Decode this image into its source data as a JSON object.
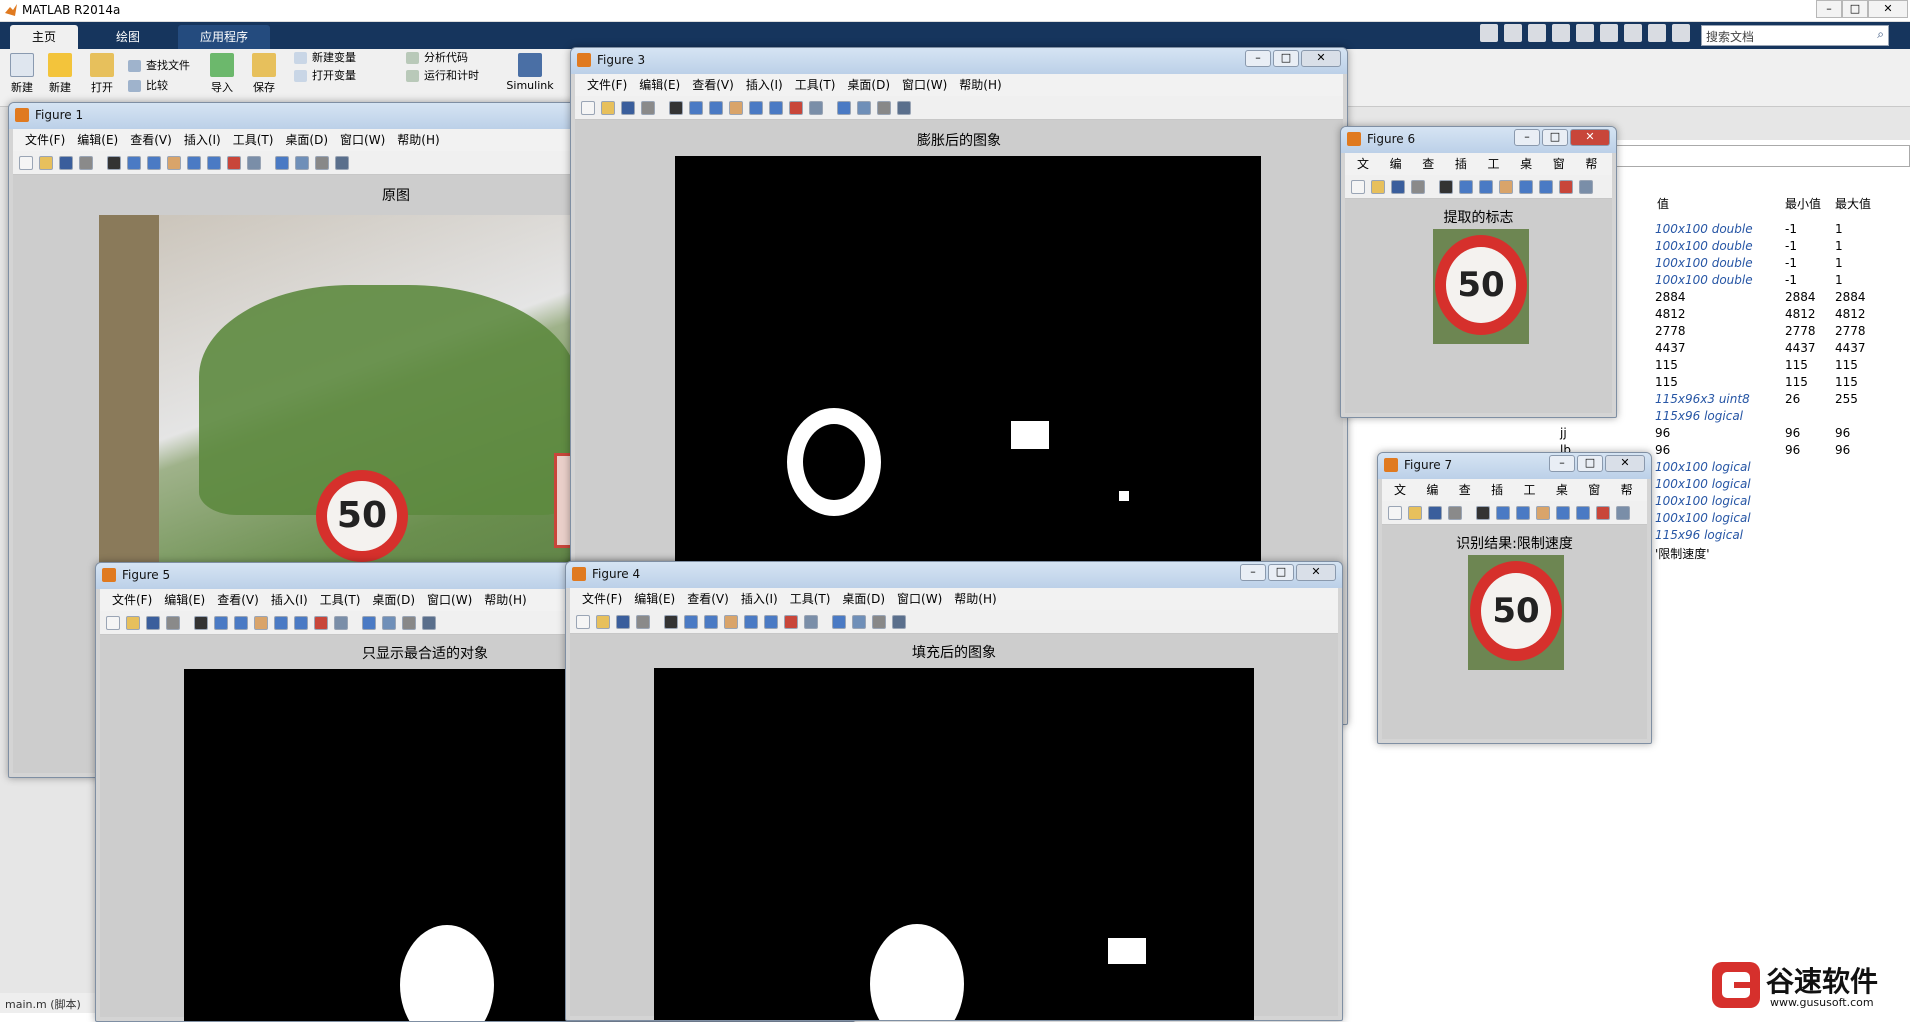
{
  "app": {
    "title": "MATLAB R2014a",
    "window_controls": [
      "–",
      "□",
      "✕"
    ]
  },
  "ribbon": {
    "tabs": [
      {
        "label": "主页",
        "active": true
      },
      {
        "label": "绘图",
        "active": false
      },
      {
        "label": "应用程序",
        "active": false
      }
    ],
    "search_placeholder": "搜索文档",
    "big_buttons": [
      "新建",
      "新建",
      "打开",
      "导入",
      "保存",
      "Simulink"
    ],
    "small_buttons": [
      "查找文件",
      "比较",
      "新建变量",
      "打开变量",
      "分析代码",
      "运行和计时"
    ]
  },
  "workspace": {
    "columns": [
      "值",
      "最小值",
      "最大值"
    ],
    "rows": [
      {
        "value": "100x100 double",
        "min": "-1",
        "max": "1",
        "italic": true
      },
      {
        "value": "100x100 double",
        "min": "-1",
        "max": "1",
        "italic": true
      },
      {
        "value": "100x100 double",
        "min": "-1",
        "max": "1",
        "italic": true
      },
      {
        "value": "100x100 double",
        "min": "-1",
        "max": "1",
        "italic": true
      },
      {
        "value": "2884",
        "min": "2884",
        "max": "2884",
        "italic": false
      },
      {
        "value": "4812",
        "min": "4812",
        "max": "4812",
        "italic": false
      },
      {
        "value": "2778",
        "min": "2778",
        "max": "2778",
        "italic": false
      },
      {
        "value": "4437",
        "min": "4437",
        "max": "4437",
        "italic": false
      },
      {
        "value": "115",
        "min": "115",
        "max": "115",
        "italic": false
      },
      {
        "value": "115",
        "min": "115",
        "max": "115",
        "italic": false
      },
      {
        "value": "115x96x3 uint8",
        "min": "26",
        "max": "255",
        "italic": true
      },
      {
        "value": "115x96 logical",
        "min": "",
        "max": "",
        "italic": true
      },
      {
        "value": "96",
        "min": "96",
        "max": "96",
        "italic": false,
        "name": "jj"
      },
      {
        "value": "96",
        "min": "96",
        "max": "96",
        "italic": false,
        "name": "lb"
      },
      {
        "value": "100x100 logical",
        "min": "",
        "max": "",
        "italic": true
      },
      {
        "value": "100x100 logical",
        "min": "",
        "max": "",
        "italic": true
      },
      {
        "value": "100x100 logical",
        "min": "",
        "max": "",
        "italic": true
      },
      {
        "value": "100x100 logical",
        "min": "",
        "max": "",
        "italic": true
      },
      {
        "value": "115x96 logical",
        "min": "",
        "max": "",
        "italic": true
      },
      {
        "value": "'限制速度'",
        "min": "",
        "max": "",
        "italic": false
      }
    ]
  },
  "status_bar": "main.m (脚本)",
  "figures": {
    "menu_full": [
      "文件(F)",
      "编辑(E)",
      "查看(V)",
      "插入(I)",
      "工具(T)",
      "桌面(D)",
      "窗口(W)",
      "帮助(H)"
    ],
    "menu_short": [
      "文件",
      "编辑",
      "查看",
      "插入",
      "工具",
      "桌面",
      "窗口",
      "帮助"
    ],
    "fig1": {
      "title": "Figure 1",
      "caption": "原图"
    },
    "fig3": {
      "title": "Figure 3",
      "caption": "膨胀后的图象"
    },
    "fig4": {
      "title": "Figure 4",
      "caption": "填充后的图象"
    },
    "fig5": {
      "title": "Figure 5",
      "caption": "只显示最合适的对象"
    },
    "fig6": {
      "title": "Figure 6",
      "caption": "提取的标志"
    },
    "fig7": {
      "title": "Figure 7",
      "caption": "识别结果:限制速度"
    },
    "sign_number": "50",
    "window_buttons": [
      "–",
      "□",
      "✕"
    ]
  },
  "watermark": {
    "brand": "谷速软件",
    "url": "www.gususoft.com"
  },
  "colors": {
    "ribbon_dark": "#16355d",
    "sign_red": "#d6302c",
    "variable_blue": "#2756a5"
  }
}
